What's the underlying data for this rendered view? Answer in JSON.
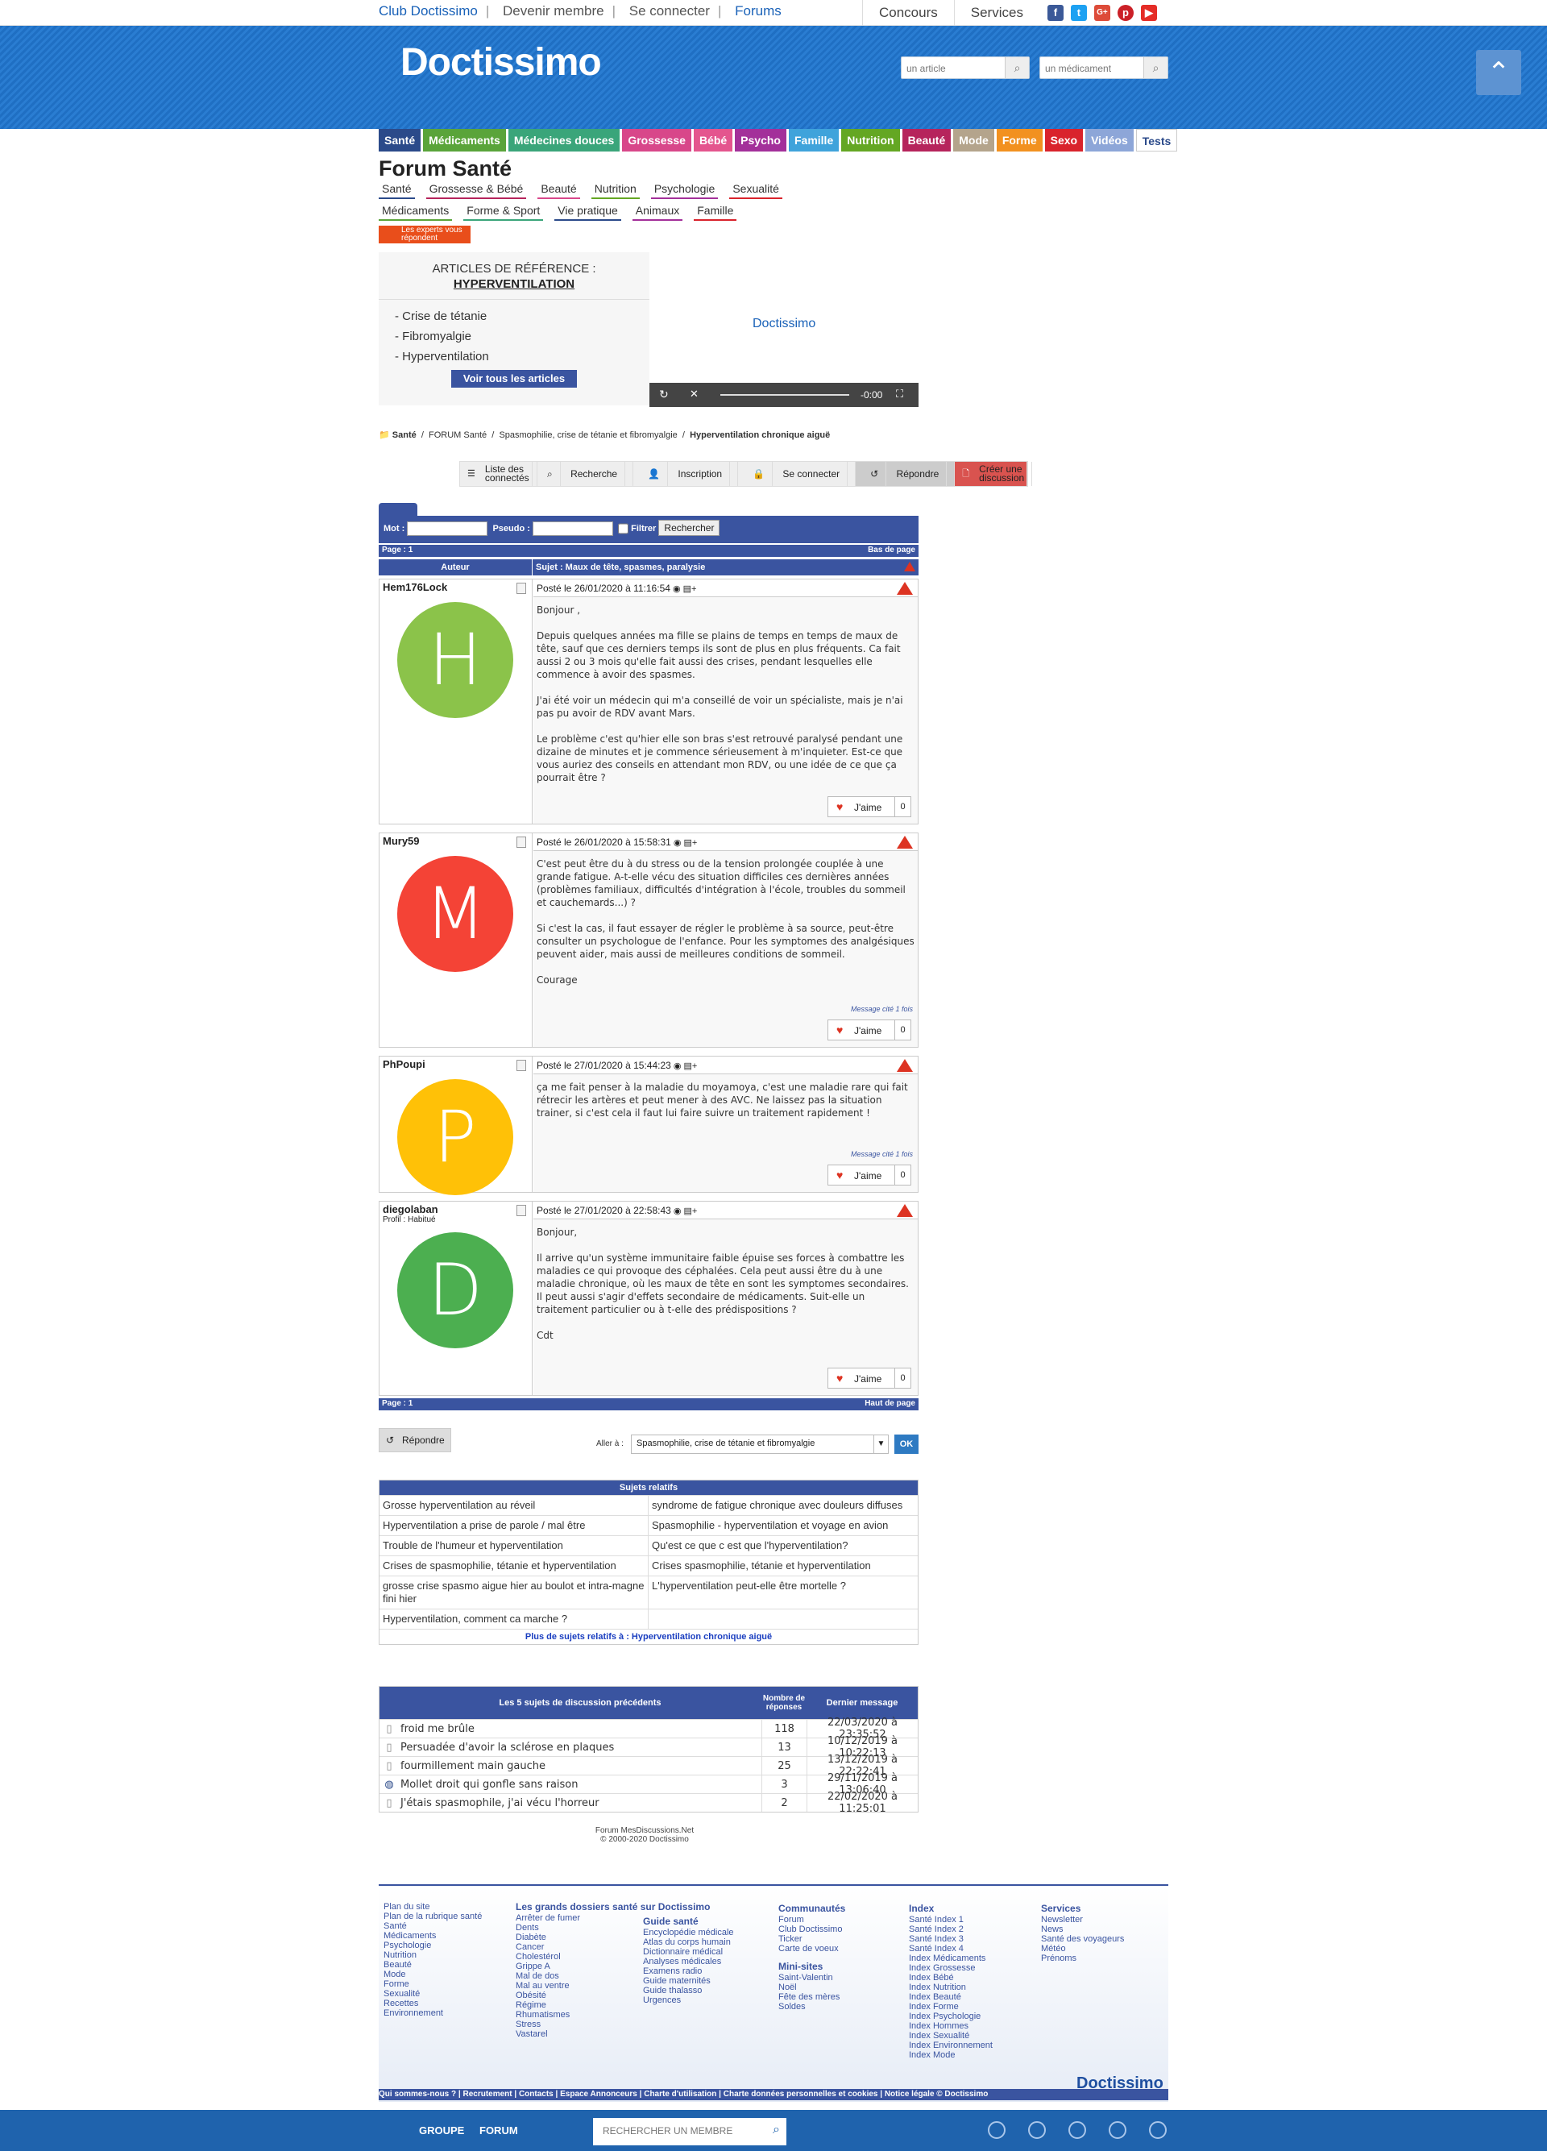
{
  "topbar": {
    "links": [
      "Club Doctissimo",
      "Devenir membre",
      "Se connecter",
      "Forums"
    ],
    "right": [
      "Concours",
      "Services"
    ],
    "social": [
      "facebook-icon",
      "twitter-icon",
      "google-plus-icon",
      "pinterest-icon",
      "youtube-icon"
    ]
  },
  "header": {
    "logo": "Doctissimo",
    "search1": "un article",
    "search2": "un médicament"
  },
  "nav": [
    {
      "label": "Santé",
      "color": "#2b4a8a"
    },
    {
      "label": "Médicaments",
      "color": "#5aa43a"
    },
    {
      "label": "Médecines douces",
      "color": "#3aa57a"
    },
    {
      "label": "Grossesse",
      "color": "#d8478a"
    },
    {
      "label": "Bébé",
      "color": "#e4558e"
    },
    {
      "label": "Psycho",
      "color": "#a3309a"
    },
    {
      "label": "Famille",
      "color": "#3fa3db"
    },
    {
      "label": "Nutrition",
      "color": "#64a723"
    },
    {
      "label": "Beauté",
      "color": "#b6245c"
    },
    {
      "label": "Mode",
      "color": "#b4a48c"
    },
    {
      "label": "Forme",
      "color": "#f29120"
    },
    {
      "label": "Sexo",
      "color": "#d9232c"
    },
    {
      "label": "Vidéos",
      "color": "#8da6d8"
    },
    {
      "label": "Tests",
      "color": "#ffffff"
    }
  ],
  "forum": {
    "title": "Forum Santé",
    "subnav": [
      "Santé",
      "Grossesse & Bébé",
      "Beauté",
      "Nutrition",
      "Psychologie",
      "Sexualité",
      "Médicaments",
      "Forme & Sport",
      "Vie pratique",
      "Animaux",
      "Famille"
    ],
    "experts": "Les experts vous répondent"
  },
  "refbox": {
    "title": "ARTICLES DE RÉFÉRENCE :",
    "subject": "HYPERVENTILATION",
    "items": [
      "- Crise de tétanie",
      "- Fibromyalgie",
      "- Hyperventilation"
    ],
    "button": "Voir tous les articles"
  },
  "video": {
    "label": "Doctissimo",
    "time": "-0:00"
  },
  "crumbs": [
    "Santé",
    "FORUM Santé",
    "Spasmophilie, crise de tétanie et fibromyalgie",
    "Hyperventilation chronique aiguë"
  ],
  "toolbar": {
    "connected": "Liste des connectés",
    "search": "Recherche",
    "signup": "Inscription",
    "login": "Se connecter",
    "reply": "Répondre",
    "new": "Créer une discussion"
  },
  "filter": {
    "mot": "Mot :",
    "pseudo": "Pseudo :",
    "filtrer": "Filtrer",
    "button": "Rechercher"
  },
  "page": {
    "label": "Page : 1",
    "bottom": "Bas de page",
    "top": "Haut de page"
  },
  "thread": {
    "author_col": "Auteur",
    "subject": "Sujet : Maux de tête, spasmes, paralysie"
  },
  "posts": [
    {
      "author": "Hem176Lock",
      "profile": "",
      "letter": "H",
      "color": "#8bc34a",
      "date": "Posté le 26/01/2020 à 11:16:54",
      "text": "Bonjour ,\n\nDepuis quelques années ma fille se plains de temps en temps de maux de tête, sauf que ces derniers temps ils sont de plus en plus fréquents. Ca fait aussi 2 ou 3 mois qu'elle fait aussi des crises, pendant lesquelles elle commence à avoir des spasmes.\n\nJ'ai été voir un médecin qui m'a conseillé de voir un spécialiste, mais je n'ai pas pu avoir de RDV avant Mars.\n\nLe problème c'est qu'hier elle son bras s'est retrouvé paralysé pendant une dizaine de minutes et je commence sérieusement à m'inquieter. Est-ce que vous auriez des conseils en attendant mon RDV, ou une idée de ce que ça pourrait être ?",
      "cite": "",
      "likes": "0"
    },
    {
      "author": "Mury59",
      "profile": "",
      "letter": "M",
      "color": "#f44336",
      "date": "Posté le 26/01/2020 à 15:58:31",
      "text": "C'est peut être du à du stress ou de la tension prolongée couplée à une grande fatigue. A-t-elle vécu des situation difficiles ces dernières années (problèmes familiaux, difficultés d'intégration à l'école, troubles du sommeil et cauchemards...) ?\n\nSi c'est la cas, il faut essayer de régler le problème à sa source, peut-être consulter un psychologue de l'enfance. Pour les symptomes des analgésiques peuvent aider, mais aussi de meilleures conditions de sommeil.\n\nCourage",
      "cite": "Message cité 1 fois",
      "likes": "0"
    },
    {
      "author": "PhPoupi",
      "profile": "",
      "letter": "P",
      "color": "#ffc107",
      "date": "Posté le 27/01/2020 à 15:44:23",
      "text": "ça me fait penser à la maladie du moyamoya, c'est une maladie rare qui fait rétrecir les artères et peut mener à des AVC. Ne laissez pas la situation trainer, si c'est cela il faut lui faire suivre un traitement rapidement !",
      "cite": "Message cité 1 fois",
      "likes": "0"
    },
    {
      "author": "diegolaban",
      "profile": "Profil : Habitué",
      "letter": "D",
      "color": "#4caf50",
      "date": "Posté le 27/01/2020 à 22:58:43",
      "text": "Bonjour,\n\nIl arrive qu'un système immunitaire faible épuise ses forces à combattre les maladies ce qui provoque des céphalées. Cela peut aussi être du à une maladie chronique, où les maux de tête en sont les symptomes secondaires. Il peut aussi s'agir d'effets secondaire de médicaments. Suit-elle un traitement particulier ou à t-elle des prédispositions ?\n\nCdt",
      "cite": "",
      "likes": "0"
    }
  ],
  "like_label": "J'aime",
  "reply_btn": "Répondre",
  "goto": {
    "label": "Aller à :",
    "value": "Spasmophilie, crise de tétanie et fibromyalgie",
    "ok": "OK"
  },
  "related": {
    "title": "Sujets relatifs",
    "rows": [
      [
        "Grosse hyperventilation au réveil",
        "syndrome de fatigue chronique avec douleurs diffuses"
      ],
      [
        "Hyperventilation a prise de parole / mal être",
        "Spasmophilie - hyperventilation et voyage en avion"
      ],
      [
        "Trouble de l'humeur et hyperventilation",
        "Qu'est ce que c est que l'hyperventilation?"
      ],
      [
        "Crises de spasmophilie, tétanie et hyperventilation",
        "Crises spasmophilie, tétanie et hyperventilation"
      ],
      [
        "grosse crise spasmo aigue hier au boulot et intra-magne fini hier",
        "L'hyperventilation peut-elle être mortelle ?"
      ],
      [
        "Hyperventilation, comment ca marche ?",
        ""
      ]
    ],
    "more": "Plus de sujets relatifs à : Hyperventilation chronique aiguë"
  },
  "previous": {
    "headers": [
      "Les 5 sujets de discussion précédents",
      "Nombre de réponses",
      "Dernier message"
    ],
    "rows": [
      {
        "title": "froid me brûle",
        "n": "118",
        "last": "22/03/2020 à 23:35:52",
        "icon": "doc"
      },
      {
        "title": "Persuadée d'avoir la sclérose en plaques",
        "n": "13",
        "last": "10/12/2019 à 10:22:13",
        "icon": "doc"
      },
      {
        "title": "fourmillement main gauche",
        "n": "25",
        "last": "13/12/2019 à 22:22:41",
        "icon": "doc"
      },
      {
        "title": "Mollet droit qui gonfle sans raison",
        "n": "3",
        "last": "29/11/2019 à 13:06:40",
        "icon": "globe"
      },
      {
        "title": "J'étais spasmophile, j'ai vécu l'horreur",
        "n": "2",
        "last": "22/02/2020 à 11:25:01",
        "icon": "doc"
      }
    ]
  },
  "copyright": [
    "Forum MesDiscussions.Net",
    "© 2000-2020 Doctissimo"
  ],
  "footer": {
    "col1": {
      "title": "",
      "items": [
        "Plan du site",
        "Plan de la rubrique santé",
        "Santé",
        "Médicaments",
        "Psychologie",
        "Nutrition",
        "Beauté",
        "Mode",
        "Forme",
        "Sexualité",
        "Recettes",
        "Environnement"
      ]
    },
    "col2": {
      "title": "Les grands dossiers santé sur Doctissimo",
      "items": [
        "Arrêter de fumer",
        "Dents",
        "Diabète",
        "Cancer",
        "Cholestérol",
        "Grippe A",
        "Mal de dos",
        "Mal au ventre",
        "Obésité",
        "Régime",
        "Rhumatismes",
        "Stress",
        "Vastarel"
      ]
    },
    "col3": {
      "title": "Guide santé",
      "items": [
        "Encyclopédie médicale",
        "Atlas du corps humain",
        "Dictionnaire médical",
        "Analyses médicales",
        "Examens radio",
        "Guide maternités",
        "Guide thalasso",
        "Urgences"
      ]
    },
    "col4": {
      "title": "Communautés",
      "items": [
        "Forum",
        "Club Doctissimo",
        "Ticker",
        "Carte de voeux"
      ],
      "title2": "Mini-sites",
      "items2": [
        "Saint-Valentin",
        "Noël",
        "Fête des mères",
        "Soldes"
      ]
    },
    "col5": {
      "title": "Index",
      "items": [
        "Santé Index 1",
        "Santé Index 2",
        "Santé Index 3",
        "Santé Index 4",
        "Index Médicaments",
        "Index Grossesse",
        "Index Bébé",
        "Index Nutrition",
        "Index Beauté",
        "Index Forme",
        "Index Psychologie",
        "Index Hommes",
        "Index Sexualité",
        "Index Environnement",
        "Index Mode"
      ]
    },
    "col6": {
      "title": "Services",
      "items": [
        "Newsletter",
        "News",
        "Santé des voyageurs",
        "Météo",
        "Prénoms"
      ]
    },
    "logo": "Doctissimo",
    "links": "Qui sommes-nous ? | Recrutement | Contacts | Espace Annonceurs | Charte d'utilisation | Charte données personnelles et cookies | Notice légale © Doctissimo"
  },
  "bottombar": {
    "groupe": "GROUPE",
    "forum": "FORUM",
    "search": "RECHERCHER UN MEMBRE"
  }
}
